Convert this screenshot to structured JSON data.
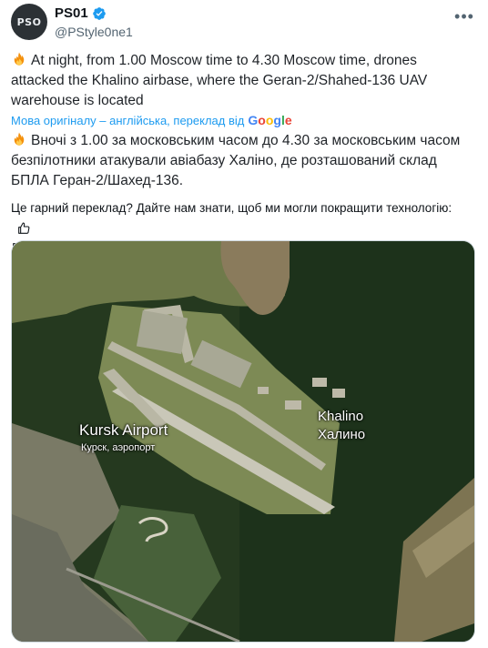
{
  "author": {
    "name": "PS01",
    "handle": "@PStyle0ne1",
    "avatar_text": "PSO",
    "verified": true
  },
  "icons": {
    "avatar": "avatar-logo",
    "verified": "verified-badge-icon",
    "more": "more-icon",
    "fire": "fire-icon",
    "thumbs_up": "thumbs-up-icon",
    "thumbs_down": "thumbs-down-icon"
  },
  "tweet": {
    "text_en": "At night, from 1.00 Moscow time to 4.30 Moscow time, drones attacked the Khalino airbase, where the Geran-2/Shahed-136 UAV warehouse is located",
    "translation_note": "Мова оригіналу – англійська, переклад від",
    "translation_provider": "Google",
    "text_uk": "Вночі з 1.00 за московським часом до 4.30 за московським часом безпілотники атакували авіабазу Халіно, де розташований склад БПЛА Геран-2/Шахед-136.",
    "feedback_prompt": "Це гарний переклад? Дайте нам знати, щоб ми могли покращити технологію:"
  },
  "map": {
    "airport_label": "Kursk Airport",
    "airport_label_local": "Курск, аэропорт",
    "village_label": "Khalino",
    "village_label_local": "Халино"
  },
  "colors": {
    "link": "#1d9bf0",
    "verified": "#1d9bf0",
    "forest": "#1f3a20",
    "water": "#8a7b5c"
  }
}
